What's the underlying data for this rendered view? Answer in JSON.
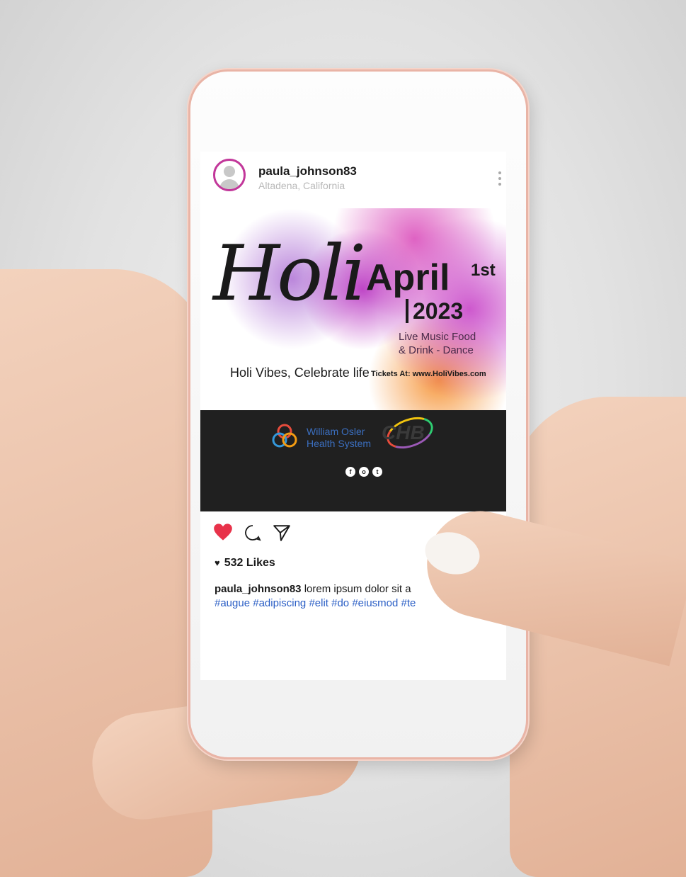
{
  "post": {
    "username": "paula_johnson83",
    "location": "Altadena, California"
  },
  "poster": {
    "script_title": "Holi",
    "month": "April",
    "day_suffix": "1st",
    "year": "2023",
    "details_line1": "Live Music Food",
    "details_line2": "& Drink - Dance",
    "tagline": "Holi Vibes, Celebrate life",
    "tickets": "Tickets At: www.HoliVibes.com",
    "sponsor_line1": "William Osler",
    "sponsor_line2": "Health System",
    "sponsor2": "CHB",
    "social_icons": [
      "f",
      "o",
      "t"
    ]
  },
  "engagement": {
    "likes_text": "532 Likes",
    "liked": true,
    "like_color": "#e8324a"
  },
  "caption": {
    "username": "paula_johnson83",
    "text": "lorem ipsum dolor sit a",
    "hashtags": "#augue  #adipiscing #elit #do #eiusmod #te"
  },
  "colors": {
    "hashtag": "#2a5ec5",
    "avatar_ring": "#c2379a"
  }
}
